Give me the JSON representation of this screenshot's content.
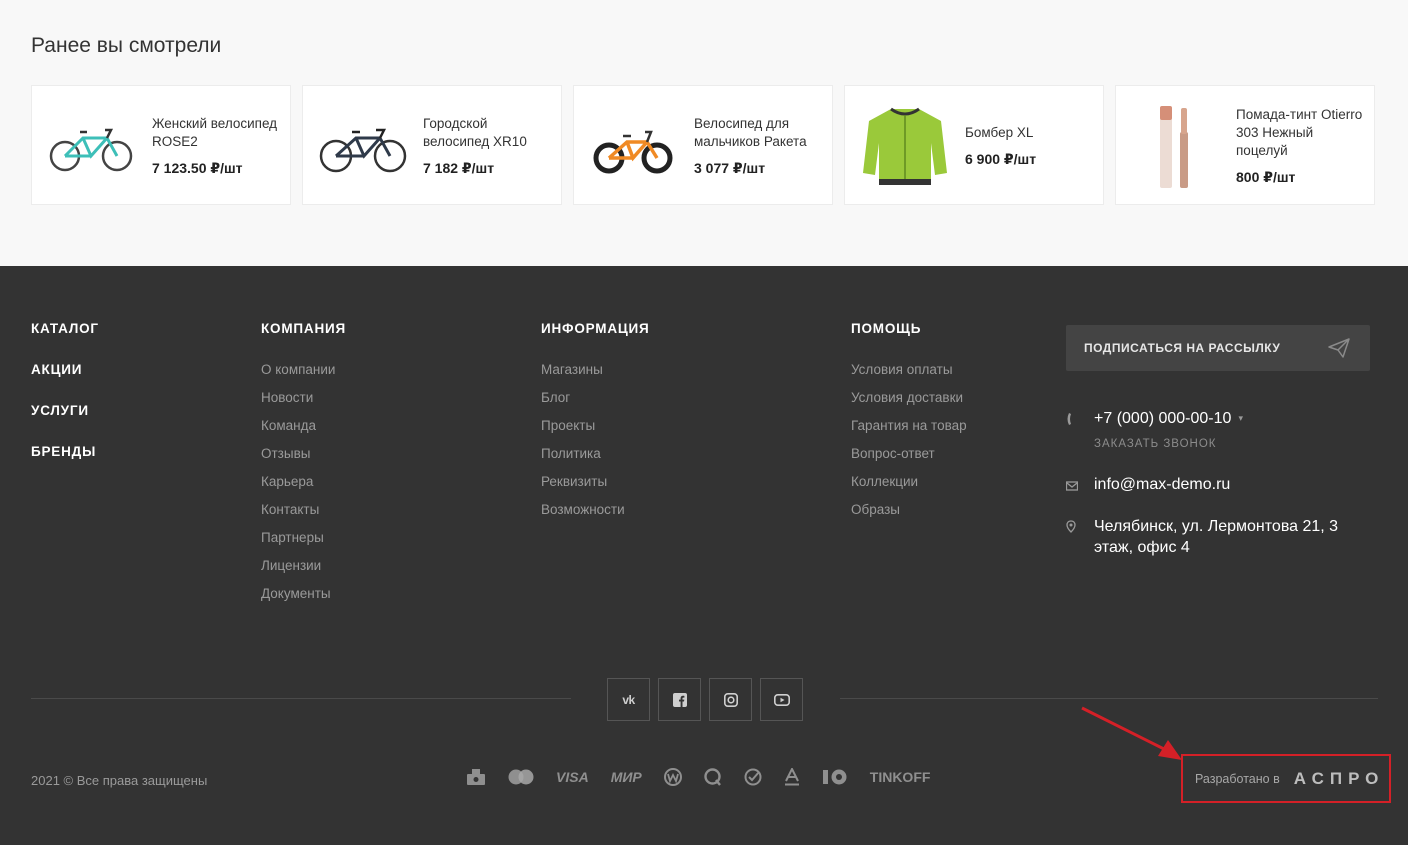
{
  "viewed": {
    "title": "Ранее вы смотрели",
    "items": [
      {
        "name": "Женский велосипед ROSE2",
        "price": "7 123.50 ₽/шт"
      },
      {
        "name": "Городской велосипед XR10",
        "price": "7 182 ₽/шт"
      },
      {
        "name": "Велосипед для мальчиков Ракета",
        "price": "3 077 ₽/шт"
      },
      {
        "name": "Бомбер XL",
        "price": "6 900 ₽/шт"
      },
      {
        "name": "Помада-тинт Otierro 303 Нежный поцелуй",
        "price": "800 ₽/шт"
      }
    ]
  },
  "footer": {
    "catalog": [
      "КАТАЛОГ",
      "АКЦИИ",
      "УСЛУГИ",
      "БРЕНДЫ"
    ],
    "company": {
      "title": "КОМПАНИЯ",
      "links": [
        "О компании",
        "Новости",
        "Команда",
        "Отзывы",
        "Карьера",
        "Контакты",
        "Партнеры",
        "Лицензии",
        "Документы"
      ]
    },
    "info": {
      "title": "ИНФОРМАЦИЯ",
      "links": [
        "Магазины",
        "Блог",
        "Проекты",
        "Политика",
        "Реквизиты",
        "Возможности"
      ]
    },
    "help": {
      "title": "ПОМОЩЬ",
      "links": [
        "Условия оплаты",
        "Условия доставки",
        "Гарантия на товар",
        "Вопрос-ответ",
        "Коллекции",
        "Образы"
      ]
    },
    "subscribe_label": "ПОДПИСАТЬСЯ НА РАССЫЛКУ",
    "phone": "+7 (000) 000-00-10",
    "callback": "ЗАКАЗАТЬ ЗВОНОК",
    "email": "info@max-demo.ru",
    "address": "Челябинск, ул. Лермонтова 21, 3 этаж, офис 4",
    "copyright": "2021 © Все права защищены",
    "payments": [
      "VISA",
      "МИР",
      "TINKOFF"
    ],
    "developer_label": "Разработано в",
    "developer_brand": "АСПРО"
  },
  "colors": {
    "footer_bg": "#333333",
    "highlight": "#d42027"
  }
}
